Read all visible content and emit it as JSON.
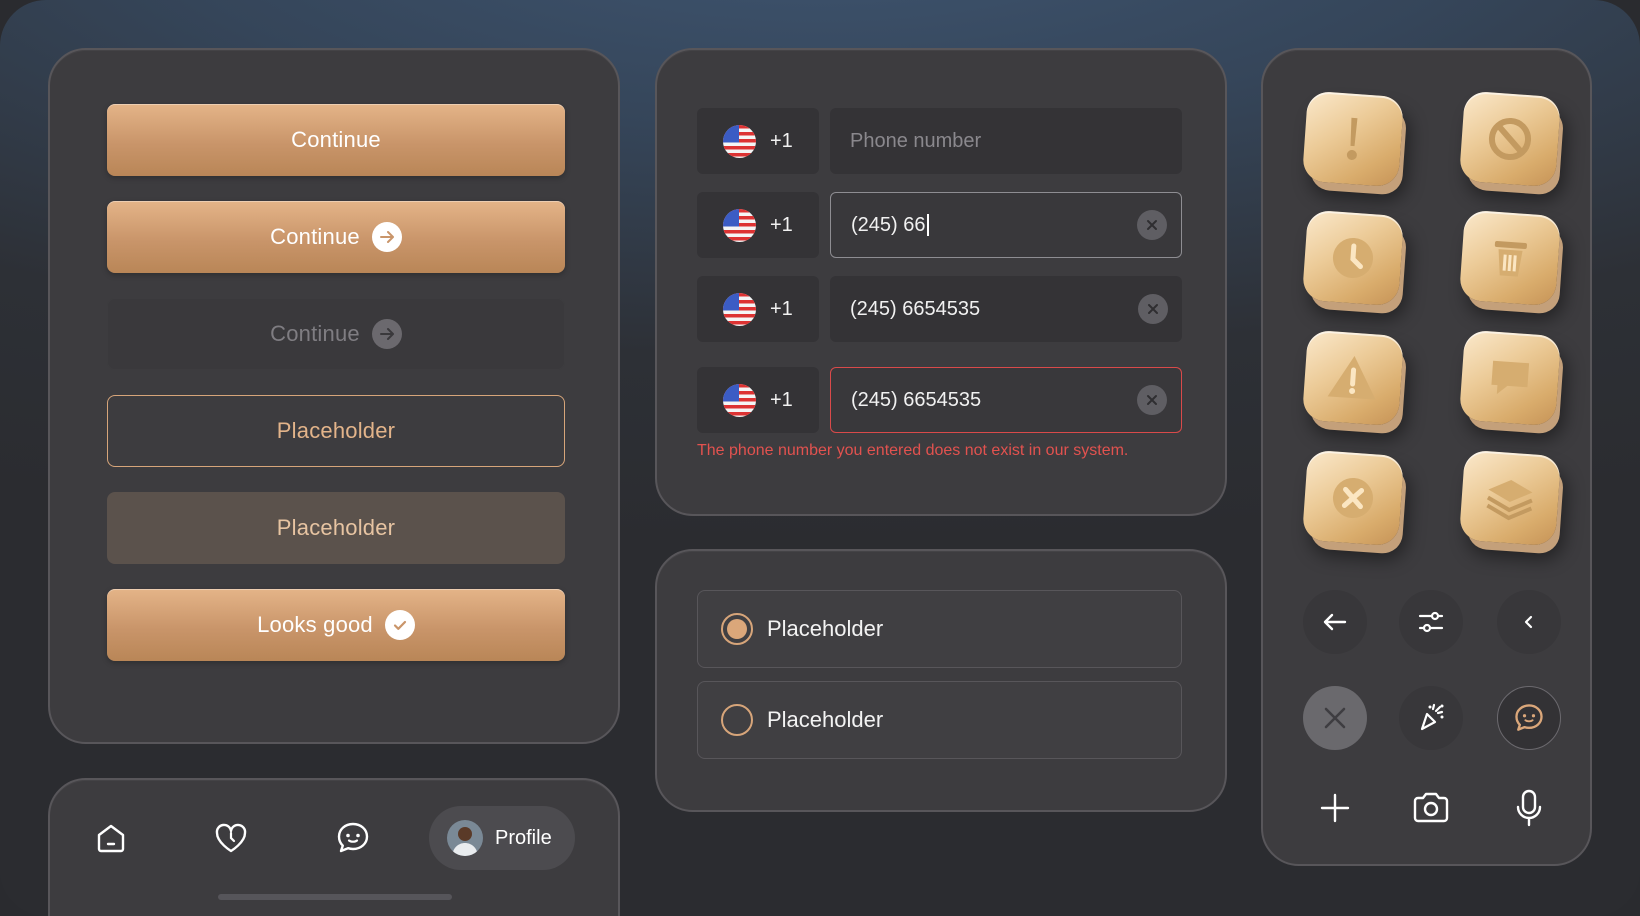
{
  "buttons": {
    "primary_label": "Continue",
    "primary_arrow_label": "Continue",
    "disabled_label": "Continue",
    "outline_label": "Placeholder",
    "tonal_label": "Placeholder",
    "success_label": "Looks good"
  },
  "phone": {
    "country_code": "+1",
    "placeholder": "Phone number",
    "typing_value": "(245) 66",
    "filled_value": "(245) 6654535",
    "error_value": "(245) 6654535",
    "error_message": "The phone number you entered does not exist in our system."
  },
  "radios": [
    {
      "label": "Placeholder",
      "selected": true
    },
    {
      "label": "Placeholder",
      "selected": false
    }
  ],
  "nav": {
    "items": [
      "home-icon",
      "heart-icon",
      "chat-icon"
    ],
    "profile_label": "Profile"
  },
  "icons_3d": [
    "exclamation-icon",
    "blocked-icon",
    "clock-icon",
    "trash-icon",
    "warning-icon",
    "chat-bubble-icon",
    "close-circle-icon",
    "layers-icon"
  ],
  "small_buttons": [
    "arrow-left-icon",
    "sliders-icon",
    "chevron-left-icon",
    "close-icon",
    "magic-icon",
    "chat-icon",
    "plus-icon",
    "camera-icon",
    "microphone-icon"
  ],
  "colors": {
    "accent": "#d7a57a",
    "error": "#e2524f",
    "panel": "#3d3c3f"
  }
}
